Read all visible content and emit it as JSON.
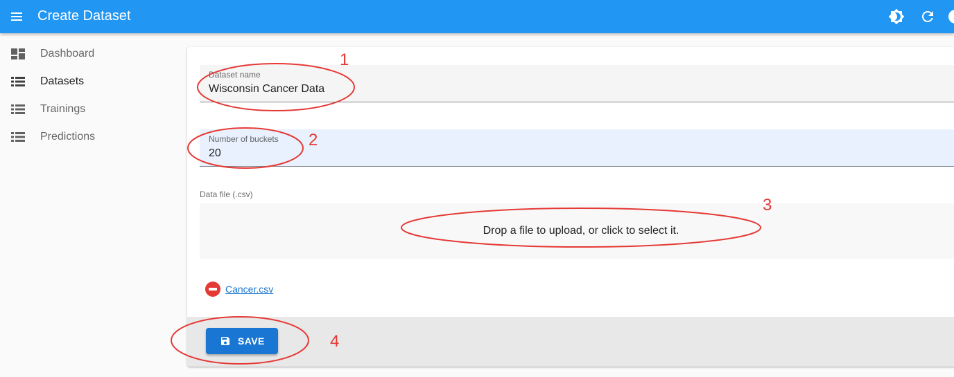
{
  "appbar": {
    "title": "Create Dataset",
    "icons": [
      "menu-icon",
      "theme-toggle-icon",
      "refresh-icon",
      "account-icon"
    ]
  },
  "sidebar": {
    "items": [
      {
        "label": "Dashboard",
        "icon": "dashboard-icon"
      },
      {
        "label": "Datasets",
        "icon": "list-icon"
      },
      {
        "label": "Trainings",
        "icon": "list-icon"
      },
      {
        "label": "Predictions",
        "icon": "list-icon"
      }
    ]
  },
  "form": {
    "dataset_name": {
      "label": "Dataset name",
      "value": "Wisconsin Cancer Data"
    },
    "buckets": {
      "label": "Number of buckets",
      "value": "20"
    },
    "data_file": {
      "label": "Data file (.csv)",
      "dropzone_text": "Drop a file to upload, or click to select it."
    },
    "uploaded_file": {
      "name": "Cancer.csv",
      "icon": "remove-circle-icon"
    }
  },
  "toolbar": {
    "save_label": "SAVE",
    "save_icon": "floppy-disk-icon"
  },
  "annotations": {
    "color": "#e53935",
    "labels": [
      "1",
      "2",
      "3",
      "4"
    ]
  },
  "colors": {
    "primary": "#2196f3",
    "button": "#1976d2",
    "danger": "#e53935"
  }
}
